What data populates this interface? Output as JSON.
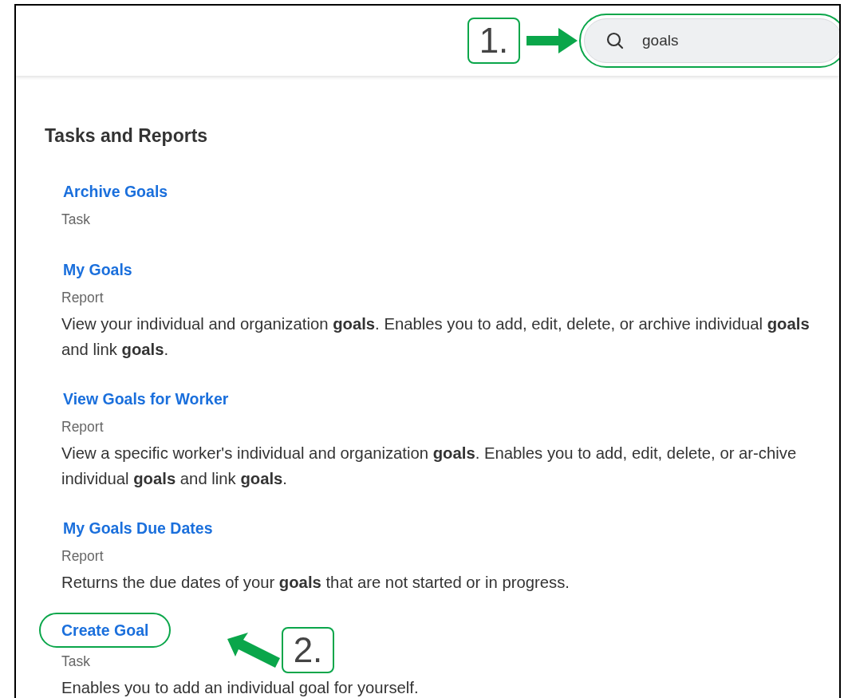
{
  "search": {
    "value": "goals",
    "highlighted": true,
    "callout": "1."
  },
  "section": {
    "title": "Tasks and Reports"
  },
  "results": [
    {
      "title": "Archive Goals",
      "type": "Task",
      "highlighted": false
    },
    {
      "title": "My Goals",
      "type": "Report",
      "description": "View your individual and organization **goals**. Enables you to add, edit, delete, or archive individual **goals** and link **goals**.",
      "highlighted": false
    },
    {
      "title": "View Goals for Worker",
      "type": "Report",
      "description": "View a specific worker's individual and organization **goals**. Enables you to add, edit, delete, or ar-chive individual **goals** and link **goals**.",
      "highlighted": false
    },
    {
      "title": "My Goals Due Dates",
      "type": "Report",
      "description": "Returns the due dates of your **goals** that are not started or in progress.",
      "highlighted": false
    },
    {
      "title": "Create Goal",
      "type": "Task",
      "description": "Enables you to add an individual goal for yourself.",
      "highlighted": true,
      "callout": "2."
    }
  ]
}
